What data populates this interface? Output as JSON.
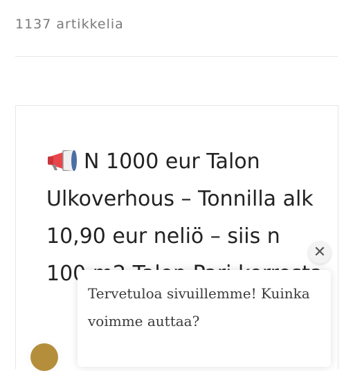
{
  "listing": {
    "article_count": "1137 artikkelia"
  },
  "article": {
    "icon": "megaphone-icon",
    "title": "N 1000 eur Talon Ulkoverhous – Tonnilla alk 10,90 eur neliö – siis n 100 m2 Talon Pari kerrosta"
  },
  "chat": {
    "welcome_message": "Tervetuloa sivuillemme! Kuinka voimme auttaa?",
    "close_symbol": "✕",
    "accent_color": "#b58e3c"
  }
}
